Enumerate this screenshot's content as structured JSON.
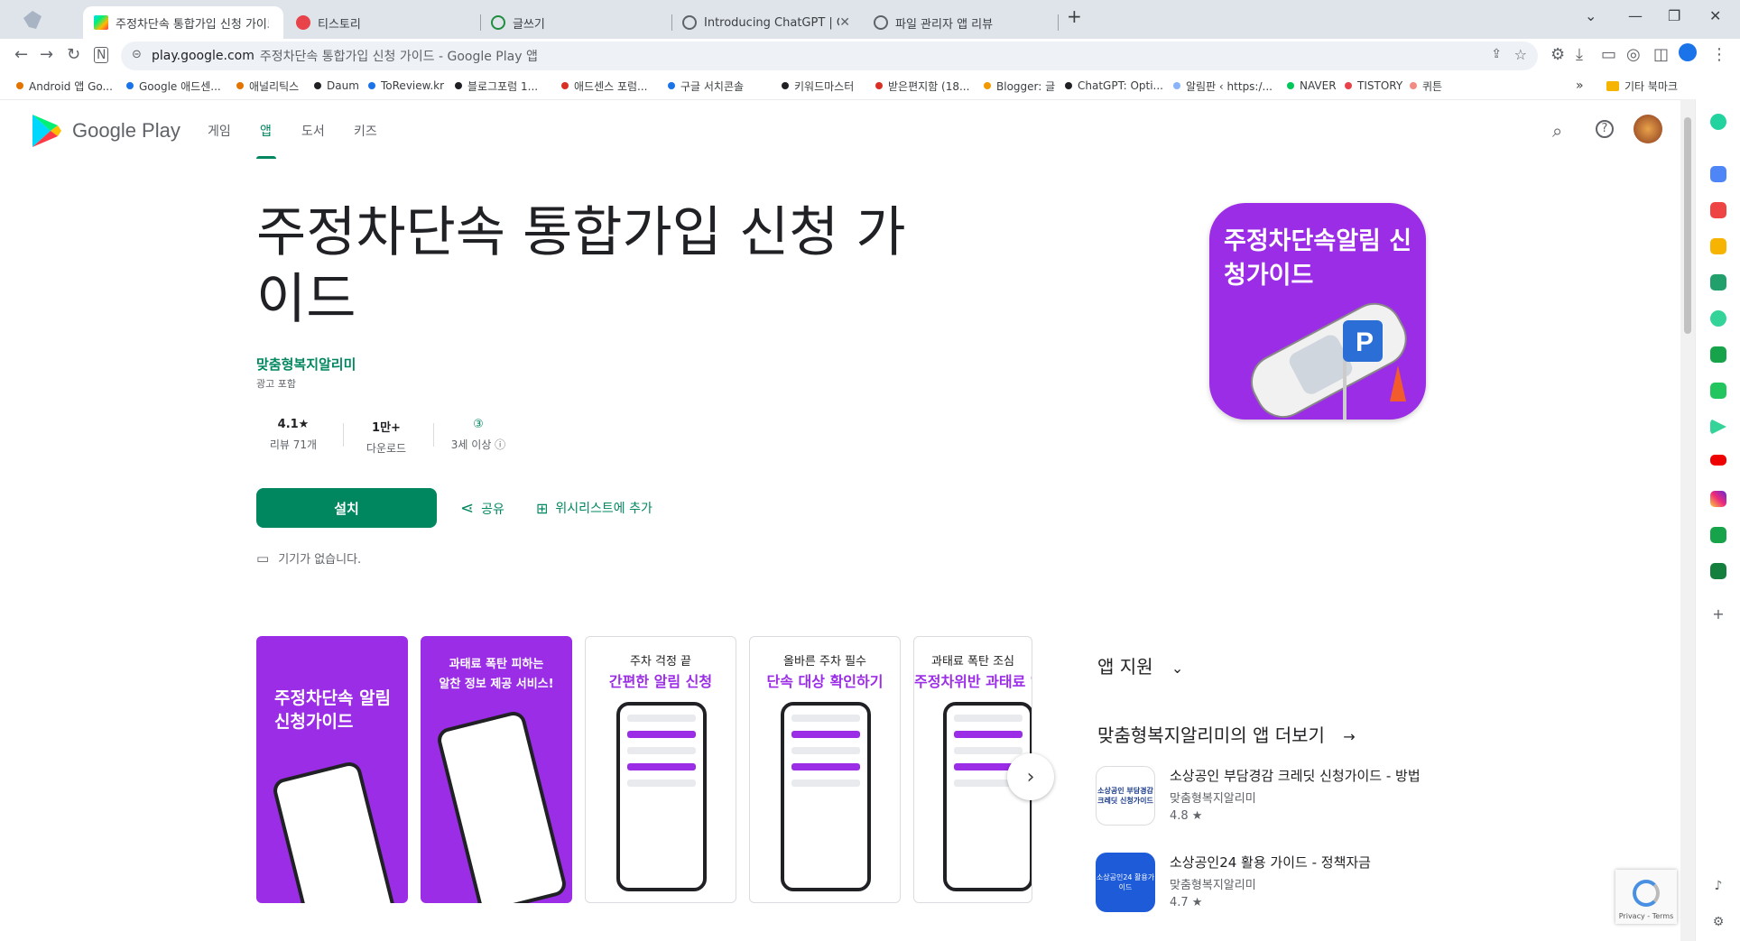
{
  "browser": {
    "tabs": [
      {
        "title": "주정차단속 통합가입 신청 가이드",
        "active": true
      },
      {
        "title": "티스토리",
        "active": false
      },
      {
        "title": "글쓰기",
        "active": false
      },
      {
        "title": "Introducing ChatGPT | Oper",
        "active": false
      },
      {
        "title": "파일 관리자 앱 리뷰",
        "active": false
      }
    ],
    "new_tab": "+",
    "close": "✕",
    "url_host": "play.google.com",
    "url_rest": "주정차단속 통합가입 신청 가이드 - Google Play 앱",
    "bookmarks": [
      {
        "label": "Android 앱 Go...",
        "color": "#e37400"
      },
      {
        "label": "Google 애드센...",
        "color": "#1a73e8"
      },
      {
        "label": "애널리틱스",
        "color": "#e37400"
      },
      {
        "label": "Daum",
        "color": "#202124"
      },
      {
        "label": "ToReview.kr",
        "color": "#1a73e8"
      },
      {
        "label": "블로그포럼 1...",
        "color": "#202124"
      },
      {
        "label": "애드센스 포럼...",
        "color": "#d93025"
      },
      {
        "label": "구글 서치콘솔",
        "color": "#1a73e8"
      },
      {
        "label": "키워드마스터",
        "color": "#202124"
      },
      {
        "label": "받은편지함 (18...",
        "color": "#d93025"
      },
      {
        "label": "Blogger: 글",
        "color": "#f29900"
      },
      {
        "label": "ChatGPT: Opti...",
        "color": "#202124"
      },
      {
        "label": "알림판 ‹ https:/...",
        "color": "#8ab4f8"
      },
      {
        "label": "NAVER",
        "color": "#03c75a"
      },
      {
        "label": "TISTORY",
        "color": "#e8434a"
      },
      {
        "label": "퀴튼",
        "color": "#f28b82"
      }
    ],
    "more_bookmarks": "»",
    "other_bookmarks": "기타 북마크"
  },
  "play": {
    "logo_text": "Google Play",
    "nav": [
      "게임",
      "앱",
      "도서",
      "키즈"
    ],
    "active_nav": "앱",
    "app_title": "주정차단속 통합가입 신청 가이드",
    "developer": "맞춤형복지알리미",
    "contains_ads": "광고 포함",
    "stats": [
      {
        "value": "4.1★",
        "label": "리뷰 71개"
      },
      {
        "value": "1만+",
        "label": "다운로드"
      },
      {
        "value": "③",
        "label": "3세 이상 ⓘ"
      }
    ],
    "install": "설치",
    "share": "공유",
    "wishlist": "위시리스트에 추가",
    "no_device": "기기가 없습니다.",
    "icon_text": "주정차단속알림 신청가이드",
    "screenshots": [
      {
        "caption1": "",
        "caption2": "주정차단속 알림 신청가이드"
      },
      {
        "caption1": "과태료 폭탄 피하는",
        "caption2": "알찬 정보 제공 서비스!"
      },
      {
        "caption1": "주차 걱정 끝",
        "caption2": "간편한 알림 신청"
      },
      {
        "caption1": "올바른 주차 필수",
        "caption2": "단속 대상 확인하기"
      },
      {
        "caption1": "과태료 폭탄 조심",
        "caption2": "주정차위반 과태료 알"
      }
    ],
    "app_support": "앱 지원",
    "more_from": "맞춤형복지알리미의 앱 더보기",
    "related": [
      {
        "name": "소상공인 부담경감 크레딧 신청가이드 - 방법",
        "dev": "맞춤형복지알리미",
        "rating": "4.8 ★",
        "icon_text": "소상공인 부담경감 크레딧 신청가이드"
      },
      {
        "name": "소상공인24 활용 가이드 - 정책자금",
        "dev": "맞춤형복지알리미",
        "rating": "4.7 ★",
        "icon_text": "소상공인24 활용가이드"
      }
    ],
    "recaptcha": "Privacy - Terms"
  },
  "colors": {
    "accent": "#01875f",
    "brand_purple": "#9b2de6"
  }
}
